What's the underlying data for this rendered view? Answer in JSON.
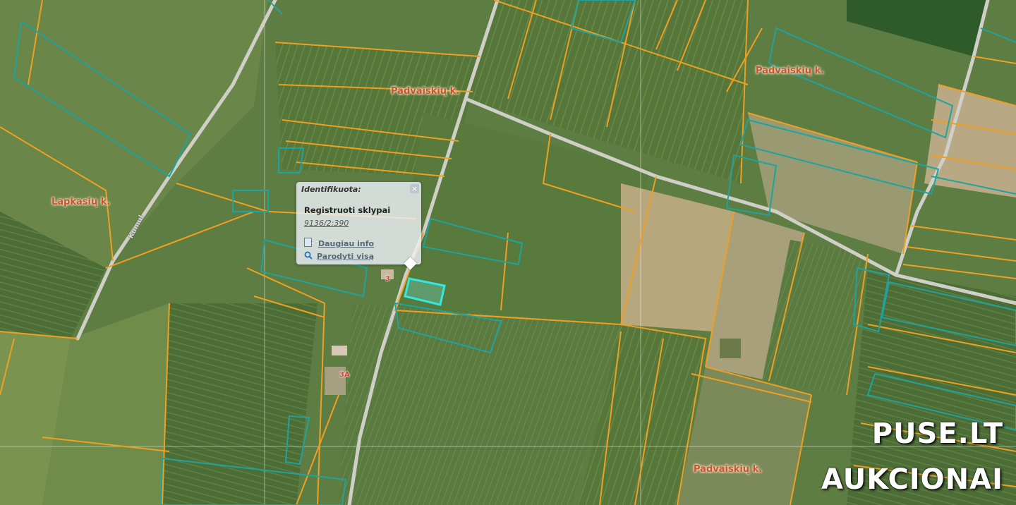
{
  "map": {
    "place_labels": [
      "Padvaiskių k.",
      "Padvaiskių k.",
      "Lapkasių k.",
      "Padvaiskių k."
    ],
    "road_label": "Kumul",
    "house_numbers": [
      "3",
      "3A"
    ],
    "colors": {
      "parcel_outline": "#f0a020",
      "registered_parcel": "#1fa3a0",
      "selected_parcel": "#33e8e0",
      "road": "#cfcfc8",
      "place_label": "#c8562a"
    }
  },
  "popup": {
    "title": "Identifikuota:",
    "close_symbol": "×",
    "layer": "Registruoti sklypai",
    "parcel_id": "9136/2:390",
    "more_info": "Daugiau info",
    "show_all": "Parodyti visą"
  },
  "watermark": {
    "line1": "PUSE.LT",
    "line2": "AUKCIONAI"
  }
}
